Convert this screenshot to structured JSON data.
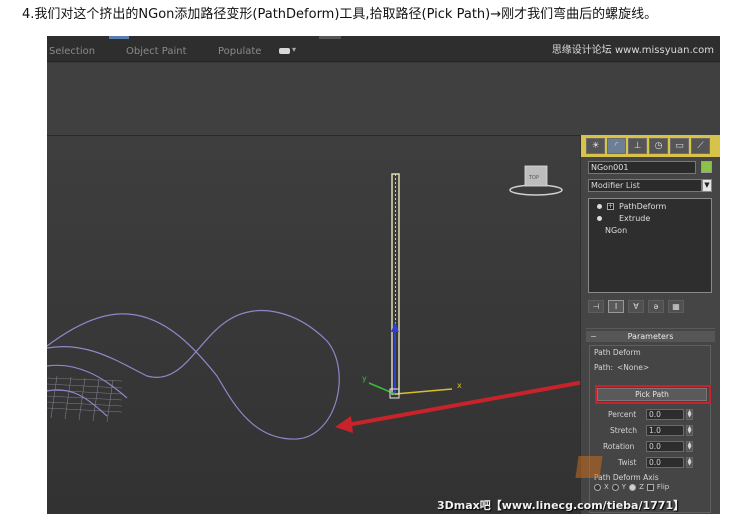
{
  "caption": "4.我们对这个挤出的NGon添加路径变形(PathDeform)工具,拾取路径(Pick Path)→刚才我们弯曲后的螺旋线。",
  "ribbon": {
    "tabs": [
      "Selection",
      "Object Paint",
      "Populate"
    ],
    "logo": "思缘设计论坛 www.missyuan.com"
  },
  "command_panel": {
    "tab_icons": [
      "sun-icon",
      "curve-icon",
      "hierarchy-icon",
      "clock-icon",
      "monitor-icon",
      "hammer-icon"
    ],
    "object_name": "NGon001",
    "object_color": "#8ac24a",
    "modifier_list_label": "Modifier List",
    "stack": [
      {
        "label": "PathDeform",
        "level": 0
      },
      {
        "label": "Extrude",
        "level": 0
      },
      {
        "label": "NGon",
        "level": 1
      }
    ],
    "parameters": {
      "header": "Parameters",
      "group_title": "Path Deform",
      "path_label": "Path:",
      "path_value": "<None>",
      "pick_button": "Pick Path",
      "fields": [
        {
          "label": "Percent",
          "value": "0.0"
        },
        {
          "label": "Stretch",
          "value": "1.0"
        },
        {
          "label": "Rotation",
          "value": "0.0"
        },
        {
          "label": "Twist",
          "value": "0.0"
        }
      ],
      "axis_title": "Path Deform Axis",
      "axis_options": [
        "X",
        "Y",
        "Z"
      ],
      "axis_selected": "Z",
      "flip_label": "Flip"
    }
  },
  "viewport": {
    "gizmo_labels": {
      "x": "x",
      "y": "y"
    },
    "viewcube_label": "TOP"
  },
  "watermark": "3Dmax吧【www.linecg.com/tieba/1771】",
  "colors": {
    "accent": "#d7c24a",
    "highlight": "#c8232a",
    "spline": "#8f86c9"
  }
}
